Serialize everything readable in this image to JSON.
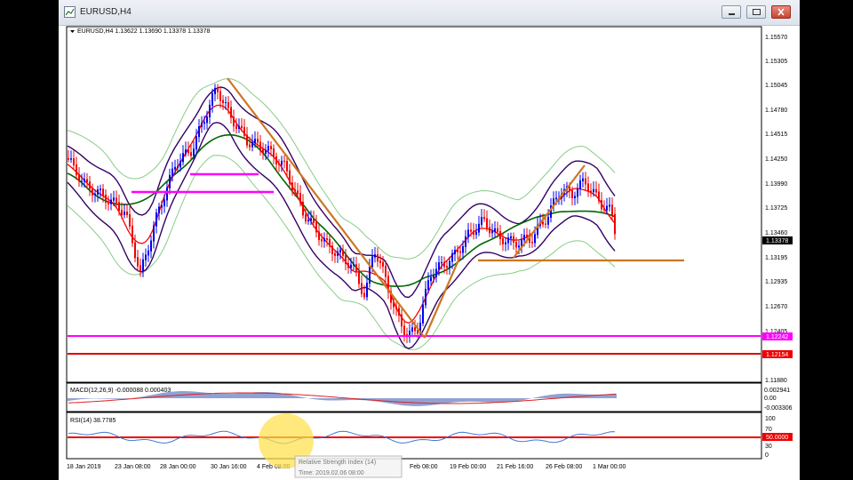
{
  "window": {
    "title": "EURUSD,H4"
  },
  "main_panel": {
    "header": "EURUSD,H4  1.13622 1.13690 1.13378 1.13378"
  },
  "price_axis": {
    "labels": [
      "1.15570",
      "1.15305",
      "1.15045",
      "1.14780",
      "1.14515",
      "1.14250",
      "1.13990",
      "1.13725",
      "1.13460",
      "1.13195",
      "1.12935",
      "1.12670",
      "1.12405",
      "1.11880"
    ],
    "current_price": "1.13378",
    "magenta_tag": "1.12242",
    "red_tag": "1.12154"
  },
  "macd_panel": {
    "header": "MACD(12,26,9) -0.000088 0.000403",
    "labels": [
      "0.002941",
      "0.00",
      "-0.003306"
    ]
  },
  "rsi_panel": {
    "header": "RSI(14) 38.7785",
    "labels": [
      "100",
      "70",
      "30",
      "0"
    ],
    "level_tag": "50.0000"
  },
  "time_axis": {
    "labels": [
      "18 Jan 2019",
      "23 Jan 08:00",
      "28 Jan 00:00",
      "30 Jan 16:00",
      "4 Feb 08:00",
      "Feb 08:00",
      "19 Feb 00:00",
      "21 Feb 16:00",
      "26 Feb 08:00",
      "1 Mar 00:00"
    ]
  },
  "tooltip": {
    "line1": "Relative Strength Index (14)",
    "line2": "Time: 2019.02.06 08:00"
  },
  "colors": {
    "bull_candle": "#0000ee",
    "bear_candle": "#ee0000",
    "ma_green": "#006600",
    "ma_red": "#ff0000",
    "bb_purple": "#330066",
    "bb_light": "#88cc88",
    "trend_orange": "#cc7722",
    "magenta": "#ff00ff"
  }
}
